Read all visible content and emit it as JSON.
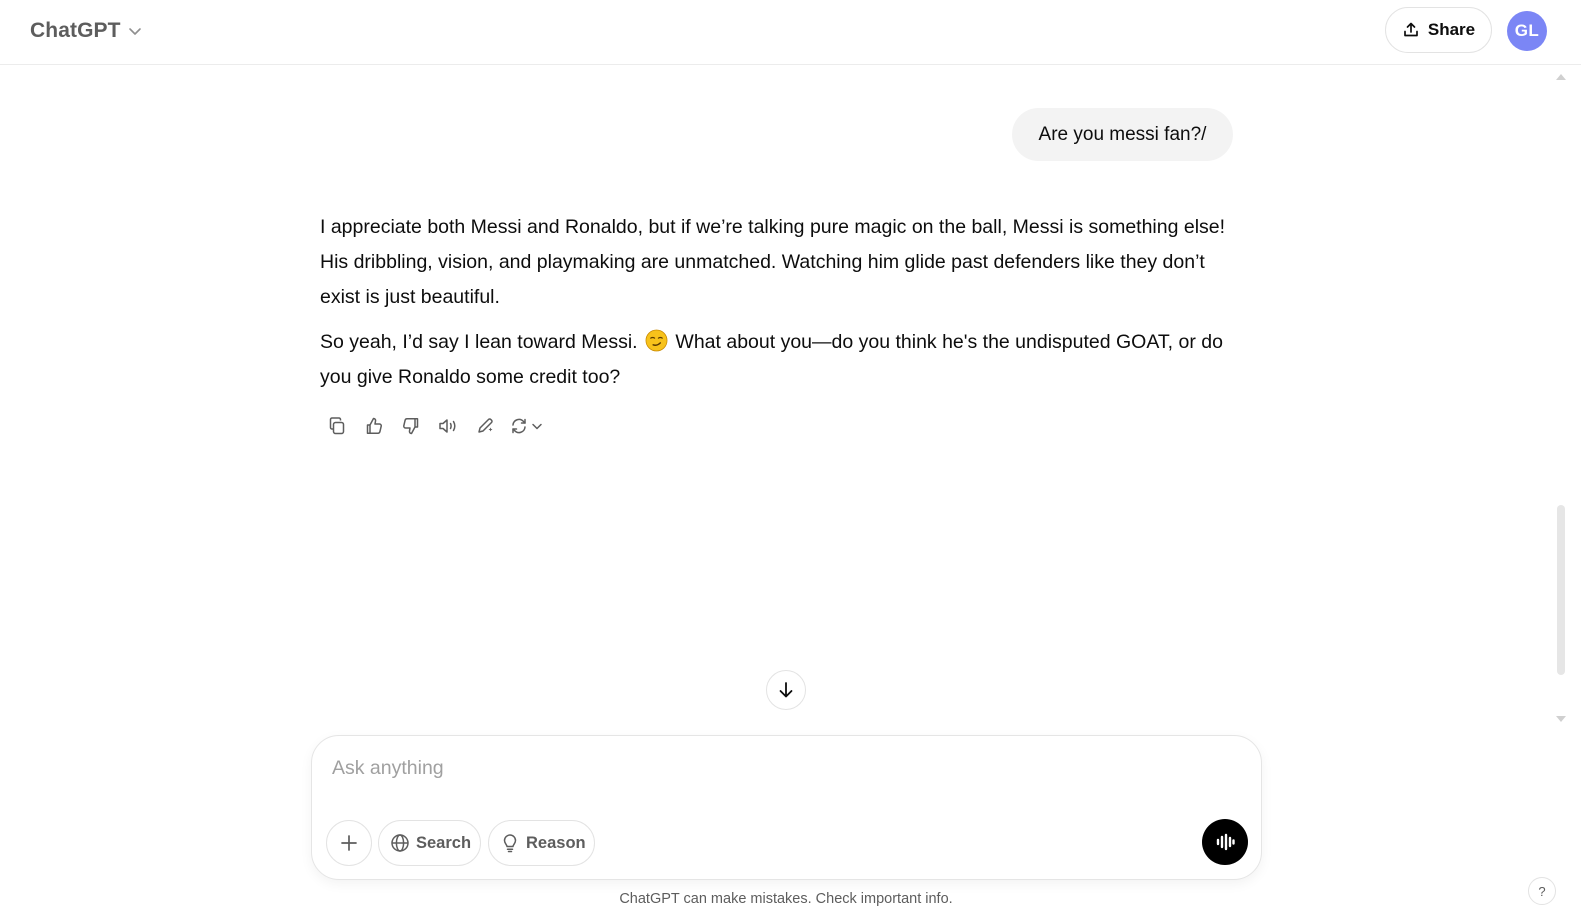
{
  "header": {
    "model_name": "ChatGPT",
    "share_label": "Share",
    "avatar_initials": "GL",
    "avatar_color": "#7b86f5"
  },
  "conversation": {
    "user_message": "Are you messi fan?/",
    "assistant_paragraphs": [
      "I appreciate both Messi and Ronaldo, but if we’re talking pure magic on the ball, Messi is something else! His dribbling, vision, and playmaking are unmatched. Watching him glide past defenders like they don’t exist is just beautiful.",
      "So yeah, I’d say I lean toward Messi.",
      "What about you—do you think he's the undisputed GOAT, or do you give Ronaldo some credit too?"
    ],
    "emoji_icon": "smirking-face-emoji",
    "message_actions": [
      "copy-icon",
      "thumbs-up-icon",
      "thumbs-down-icon",
      "read-aloud-icon",
      "edit-in-canvas-icon",
      "regenerate-icon"
    ]
  },
  "composer": {
    "placeholder": "Ask anything",
    "value": "",
    "search_label": "Search",
    "reason_label": "Reason"
  },
  "footer": {
    "disclaimer": "ChatGPT can make mistakes. Check important info.",
    "help_label": "?"
  }
}
